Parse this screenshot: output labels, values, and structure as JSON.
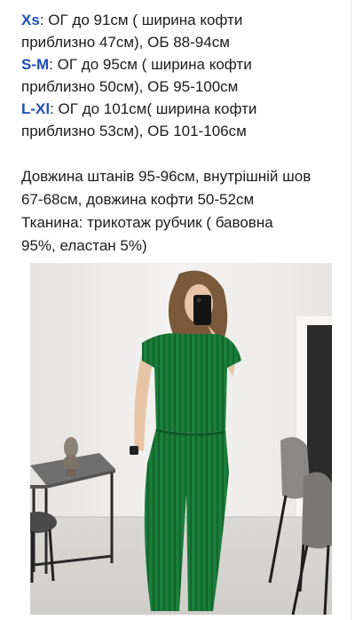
{
  "sizes": [
    {
      "label": "Xs",
      "line1": ": ОГ до 91см ( ширина кофти",
      "line2": "приблизно 47см), ОБ 88-94см"
    },
    {
      "label": "S-M",
      "line1": ": ОГ до 95см ( ширина кофти",
      "line2": "приблизно 50см), ОБ 95-100см"
    },
    {
      "label": "L-Xl",
      "line1": ":  ОГ до 101см( ширина кофти",
      "line2": "приблизно 53см), ОБ 101-106см"
    }
  ],
  "details": {
    "line1": "Довжина штанів 95-96см, внутрішній шов",
    "line2": "67-68см, довжина кофти 50-52см",
    "line3": "Тканина: трикотаж рубчик ( бавовна",
    "line4": "95%, еластан 5%)"
  },
  "colors": {
    "label_blue": "#1f4fb8",
    "outfit_green": "#1b7d3a",
    "wall": "#eceae6"
  }
}
